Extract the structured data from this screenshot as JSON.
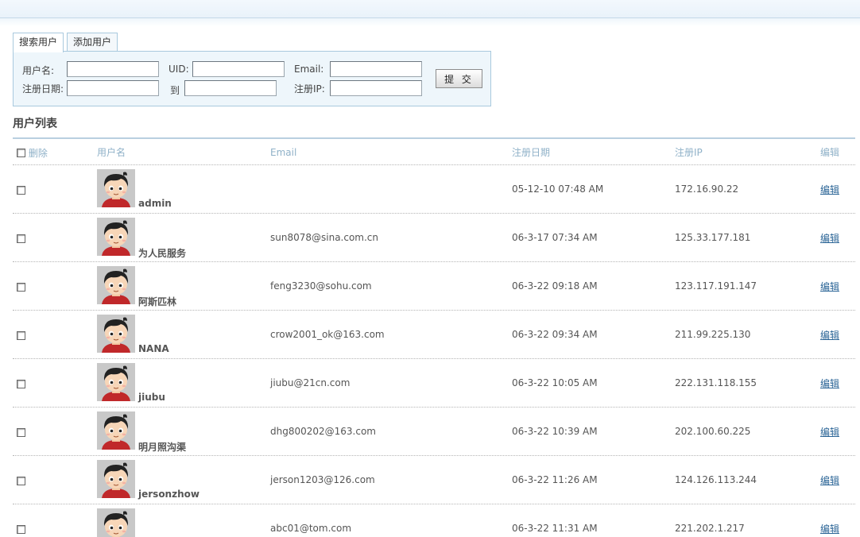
{
  "tabs": [
    {
      "label": "搜索用户",
      "active": true
    },
    {
      "label": "添加用户",
      "active": false
    }
  ],
  "search": {
    "username_label": "用户名:",
    "uid_label": "UID:",
    "email_label": "Email:",
    "regdate_label": "注册日期:",
    "to_label": "到",
    "regip_label": "注册IP:",
    "submit_label": "提 交",
    "username_value": "",
    "uid_value": "",
    "email_value": "",
    "regdate_from_value": "",
    "regdate_to_value": "",
    "regip_value": ""
  },
  "list": {
    "title": "用户列表",
    "headers": {
      "delete": "删除",
      "username": "用户名",
      "email": "Email",
      "regdate": "注册日期",
      "regip": "注册IP",
      "edit": "编辑"
    },
    "edit_link": "编辑",
    "rows": [
      {
        "username": "admin",
        "email": "",
        "date": "05-12-10 07:48 AM",
        "ip": "172.16.90.22"
      },
      {
        "username": "为人民服务",
        "email": "sun8078@sina.com.cn",
        "date": "06-3-17 07:34 AM",
        "ip": "125.33.177.181"
      },
      {
        "username": "阿斯匹林",
        "email": "feng3230@sohu.com",
        "date": "06-3-22 09:18 AM",
        "ip": "123.117.191.147"
      },
      {
        "username": "NANA",
        "email": "crow2001_ok@163.com",
        "date": "06-3-22 09:34 AM",
        "ip": "211.99.225.130"
      },
      {
        "username": "jiubu",
        "email": "jiubu@21cn.com",
        "date": "06-3-22 10:05 AM",
        "ip": "222.131.118.155"
      },
      {
        "username": "明月照沟渠",
        "email": "dhg800202@163.com",
        "date": "06-3-22 10:39 AM",
        "ip": "202.100.60.225"
      },
      {
        "username": "jersonzhow",
        "email": "jerson1203@126.com",
        "date": "06-3-22 11:26 AM",
        "ip": "124.126.113.244"
      },
      {
        "username": "",
        "email": "abc01@tom.com",
        "date": "06-3-22 11:31 AM",
        "ip": "221.202.1.217"
      }
    ]
  },
  "colors": {
    "header_text": "#8fb1c8",
    "link": "#2a6496",
    "panel_bg": "#eef6fb",
    "panel_border": "#a9c9de"
  },
  "icons": {
    "avatar": "default-cartoon-avatar-icon",
    "checkbox": "checkbox-icon"
  }
}
